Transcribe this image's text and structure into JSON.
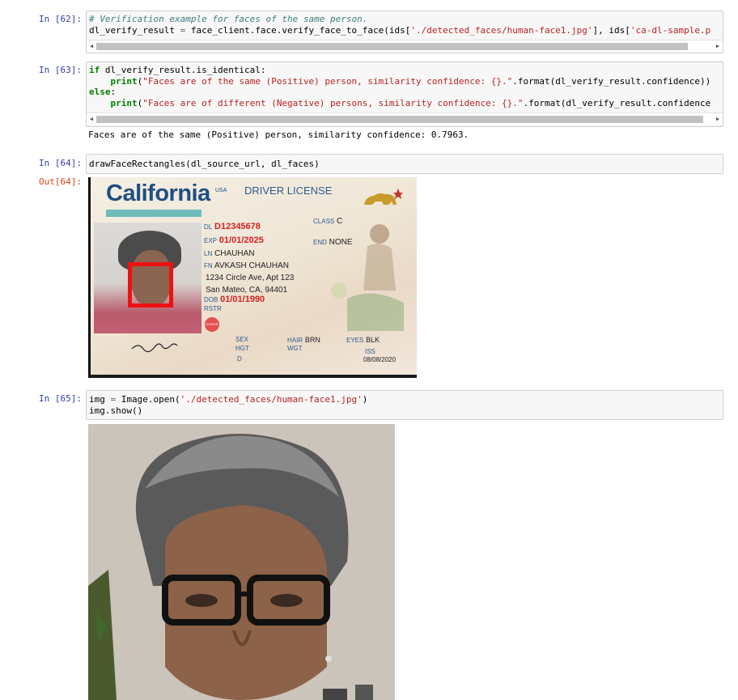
{
  "cells": [
    {
      "prompt": "In [62]:",
      "lines": [
        [
          {
            "t": "c",
            "v": "# Verification example for faces of the same person."
          }
        ],
        [
          {
            "t": "n",
            "v": "dl_verify_result "
          },
          {
            "t": "o",
            "v": "="
          },
          {
            "t": "n",
            "v": " face_client.face.verify_face_to_face(ids["
          },
          {
            "t": "s",
            "v": "'./detected_faces/human-face1.jpg'"
          },
          {
            "t": "n",
            "v": "], ids["
          },
          {
            "t": "s",
            "v": "'ca-dl-sample.p"
          }
        ]
      ]
    },
    {
      "prompt": "In [63]:",
      "lines": [
        [
          {
            "t": "k",
            "v": "if"
          },
          {
            "t": "n",
            "v": " dl_verify_result.is_identical:"
          }
        ],
        [
          {
            "t": "n",
            "v": "    "
          },
          {
            "t": "k",
            "v": "print"
          },
          {
            "t": "n",
            "v": "("
          },
          {
            "t": "s",
            "v": "\"Faces are of the same (Positive) person, similarity confidence: {}.\""
          },
          {
            "t": "n",
            "v": ".format(dl_verify_result.confidence))"
          }
        ],
        [
          {
            "t": "k",
            "v": "else"
          },
          {
            "t": "n",
            "v": ":"
          }
        ],
        [
          {
            "t": "n",
            "v": "    "
          },
          {
            "t": "k",
            "v": "print"
          },
          {
            "t": "n",
            "v": "("
          },
          {
            "t": "s",
            "v": "\"Faces are of different (Negative) persons, similarity confidence: {}.\""
          },
          {
            "t": "n",
            "v": ".format(dl_verify_result.confidence"
          }
        ]
      ],
      "output": "Faces are of the same (Positive) person, similarity confidence: 0.7963."
    },
    {
      "prompt": "In [64]:",
      "lines": [
        [
          {
            "t": "n",
            "v": "drawFaceRectangles(dl_source_url, dl_faces)"
          }
        ]
      ],
      "out_prompt": "Out[64]:"
    },
    {
      "prompt": "In [65]:",
      "lines": [
        [
          {
            "t": "n",
            "v": "img "
          },
          {
            "t": "o",
            "v": "="
          },
          {
            "t": "n",
            "v": " Image.open("
          },
          {
            "t": "s",
            "v": "'./detected_faces/human-face1.jpg'"
          },
          {
            "t": "n",
            "v": ")"
          }
        ],
        [
          {
            "t": "n",
            "v": "img.show()"
          }
        ]
      ]
    }
  ],
  "license": {
    "title": "California",
    "usa": "USA",
    "doc": "DRIVER LICENSE",
    "dl_label": "DL",
    "dl": "D12345678",
    "class_label": "CLASS",
    "class": "C",
    "exp_label": "EXP",
    "exp": "01/01/2025",
    "end_label": "END",
    "end": "NONE",
    "ln_label": "LN",
    "ln": "CHAUHAN",
    "fn_label": "FN",
    "fn": "AVKASH CHAUHAN",
    "addr1": "1234 Circle Ave, Apt 123",
    "addr2": "San Mateo, CA, 94401",
    "dob_label": "DOB",
    "dob": "01/01/1990",
    "rstr_label": "RSTR",
    "donor": "DONOR",
    "sex_label": "SEX",
    "hair_label": "HAIR",
    "hair": "BRN",
    "eyes_label": "EYES",
    "eyes": "BLK",
    "hgt_label": "HGT",
    "wgt_label": "WGT",
    "iss_label": "ISS",
    "iss": "08/08/2020",
    "d_label": "D"
  },
  "colors": {
    "in_prompt": "#303f9f",
    "out_prompt": "#d84315",
    "face_box": "#ee1111"
  }
}
